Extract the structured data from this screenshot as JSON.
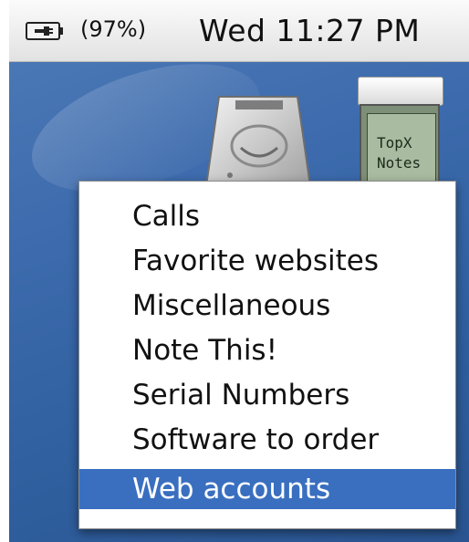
{
  "menubar": {
    "battery_percent": "(97%)",
    "clock": "Wed 11:27 PM",
    "battery_icon": "battery-plug-icon"
  },
  "desktop": {
    "drive_icon": "hard-drive-icon"
  },
  "widget": {
    "name_line1": "TopX",
    "name_line2": "Notes"
  },
  "menu": {
    "items": [
      {
        "label": "Calls"
      },
      {
        "label": "Favorite websites"
      },
      {
        "label": "Miscellaneous"
      },
      {
        "label": "Note This!"
      },
      {
        "label": "Serial Numbers"
      },
      {
        "label": "Software to order"
      },
      {
        "label": "Web accounts",
        "selected": true
      }
    ]
  },
  "colors": {
    "selection": "#3a6fc0",
    "desktop": "#3d6bad"
  }
}
